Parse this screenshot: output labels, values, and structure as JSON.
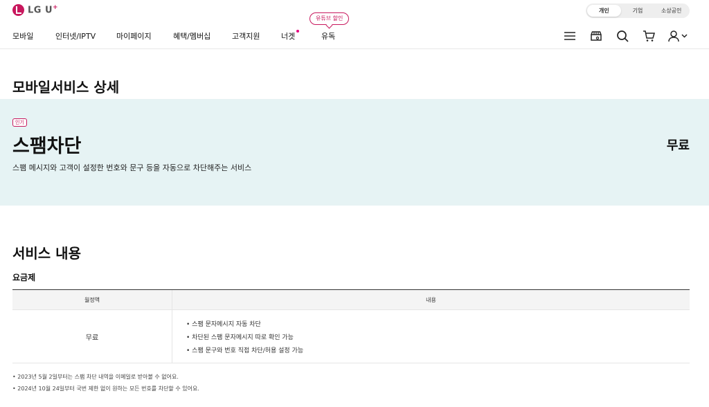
{
  "header": {
    "logo_text": "LG U",
    "logo_plus": "+",
    "segments": [
      "개인",
      "기업",
      "소상공인"
    ]
  },
  "nav": {
    "items": [
      "모바일",
      "인터넷/IPTV",
      "마이페이지",
      "혜택/멤버십",
      "고객지원",
      "너겟",
      "유독"
    ],
    "promo_bubble": "유튜브 할인"
  },
  "page": {
    "title": "모바일서비스 상세"
  },
  "hero": {
    "badge": "인기",
    "name": "스팸차단",
    "description": "스팸 메시지와 고객이 설정한 번호와 문구 등을 자동으로 차단해주는 서비스",
    "price": "무료"
  },
  "section": {
    "title": "서비스 내용",
    "subtitle": "요금제",
    "table": {
      "headers": [
        "월정액",
        "내용"
      ],
      "row": {
        "fee": "무료",
        "details": [
          "• 스팸 문자메시지 자동 차단",
          "• 차단된 스팸 문자메시지 따로 확인 가능",
          "• 스팸 문구와 번호 직접 차단/허용 설정 가능"
        ]
      }
    },
    "notes": [
      "• 2023년 5월 2일부터는 스팸 차단 내역을 이메일로 받아볼 수 없어요.",
      "• 2024년 10월 24일부터 국번 제한 없이 원하는 모든 번호를 차단할 수 있어요."
    ]
  },
  "colors": {
    "brand": "#c8175d",
    "hero_bg": "#e6f3f4"
  }
}
